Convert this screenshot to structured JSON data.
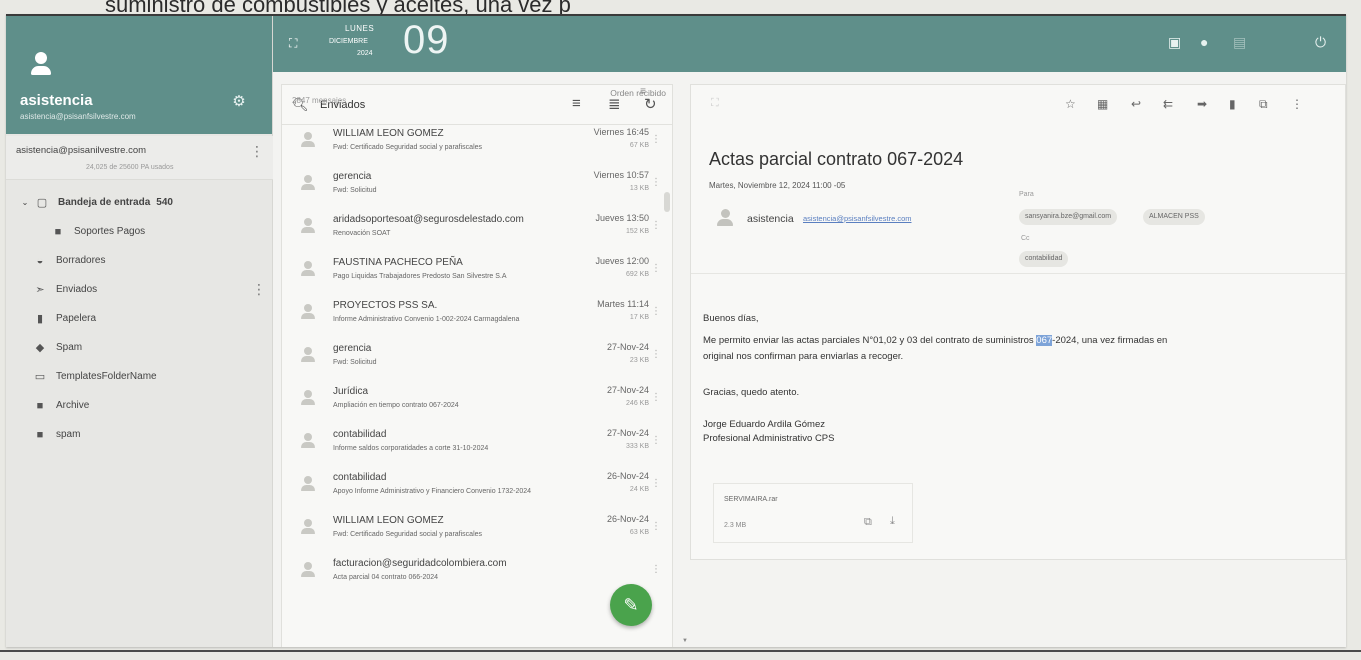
{
  "caption": "suministro de combustibles y aceites, una vez p",
  "account": {
    "name": "asistencia",
    "email": "asistencia@psisanfsilvestre.com",
    "row_address": "asistencia@psisanilvestre.com",
    "quota": "24,025 de 25600 PA usados"
  },
  "folders": [
    {
      "label": "Bandeja de entrada",
      "count": "540",
      "icon": "inbox-icon",
      "glyph": "▢"
    },
    {
      "label": "Soportes Pagos",
      "icon": "folder-icon",
      "glyph": "■"
    },
    {
      "label": "Borradores",
      "icon": "drafts-icon",
      "glyph": "◒"
    },
    {
      "label": "Enviados",
      "icon": "send-icon",
      "glyph": "➣"
    },
    {
      "label": "Papelera",
      "icon": "trash-icon",
      "glyph": "▮"
    },
    {
      "label": "Spam",
      "icon": "spam-icon",
      "glyph": "◆"
    },
    {
      "label": "TemplatesFolderName",
      "icon": "template-icon",
      "glyph": "▭"
    },
    {
      "label": "Archive",
      "icon": "folder-icon",
      "glyph": "■"
    },
    {
      "label": "spam",
      "icon": "folder-icon",
      "glyph": "■"
    }
  ],
  "topbar": {
    "day": "LUNES",
    "month": "DICIEMBRE",
    "year": "2024",
    "date_number": "09"
  },
  "list": {
    "search_text": "Enviados",
    "count": "2847 mensajes",
    "sort_label": "Orden recibido",
    "messages": [
      {
        "sender": "WILLIAM LEON GOMEZ",
        "subject": "Fwd: Certificado Seguridad social y parafiscales",
        "date": "Viernes 16:45",
        "size": "67 KB"
      },
      {
        "sender": "gerencia",
        "subject": "Fwd: Solicitud",
        "date": "Viernes 10:57",
        "size": "13 KB"
      },
      {
        "sender": "aridadsoportesoat@segurosdelestado.com",
        "subject": "Renovación SOAT",
        "date": "Jueves 13:50",
        "size": "152 KB"
      },
      {
        "sender": "FAUSTINA PACHECO PEÑA",
        "subject": "Pago Liquidas Trabajadores Predosto San Silvestre S.A",
        "date": "Jueves 12:00",
        "size": "692 KB"
      },
      {
        "sender": "PROYECTOS PSS SA.",
        "subject": "Informe Administrativo Convenio 1-002-2024 Carmagdalena",
        "date": "Martes 11:14",
        "size": "17 KB"
      },
      {
        "sender": "gerencia",
        "subject": "Fwd: Solicitud",
        "date": "27-Nov-24",
        "size": "23 KB"
      },
      {
        "sender": "Jurídica",
        "subject": "Ampliación en tiempo contrato 067-2024",
        "date": "27-Nov-24",
        "size": "246 KB"
      },
      {
        "sender": "contabilidad",
        "subject": "Informe saldos corporatidades a corte 31-10-2024",
        "date": "27-Nov-24",
        "size": "333 KB"
      },
      {
        "sender": "contabilidad",
        "subject": "Apoyo Informe Administrativo y Financiero Convenio 1732-2024",
        "date": "26-Nov-24",
        "size": "24 KB"
      },
      {
        "sender": "WILLIAM LEON GOMEZ",
        "subject": "Fwd: Certificado Seguridad social y parafiscales",
        "date": "26-Nov-24",
        "size": "63 KB"
      },
      {
        "sender": "facturacion@seguridadcolombiera.com",
        "subject": "Acta parcial 04 contrato 066-2024",
        "date": "",
        "size": ""
      }
    ]
  },
  "reader": {
    "subject": "Actas parcial contrato 067-2024",
    "date": "Martes, Noviembre 12, 2024 11:00 -05",
    "from_name": "asistencia",
    "from_email": "asistencia@psisanfsilvestre.com",
    "to_label": "Para",
    "to": [
      "sansyanira.bze@gmail.com",
      "ALMACEN PSS"
    ],
    "cc_label": "Cc",
    "cc": [
      "contabilidad"
    ],
    "greeting": "Buenos días,",
    "body_before": "Me permito enviar las actas parciales N°01,02 y 03 del contrato de suministros ",
    "body_highlight": "067",
    "body_after": "-2024, una vez firmadas en",
    "body_line2": "original nos confirman para enviarlas a recoger.",
    "thanks": "Gracias, quedo atento.",
    "signature_name": "Jorge Eduardo Ardila Gómez",
    "signature_title": "Profesional Administrativo CPS",
    "attachment_name": "SERVIMAIRA.rar",
    "attachment_size": "2.3 MB"
  },
  "colors": {
    "header": "#5f8f8a",
    "compose": "#4aa34c",
    "highlight": "#7da3d8"
  }
}
